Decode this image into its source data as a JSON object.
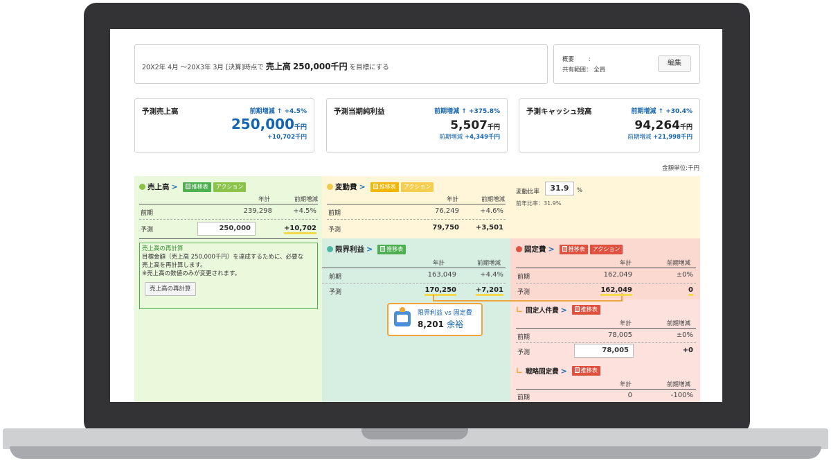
{
  "goal": {
    "prefix": "20X2年 4月 ～20X3年 3月 [決算]時点で",
    "metric": "売上高",
    "amount": "250,000千円",
    "suffix": "を目標にする",
    "overview_label": "概要",
    "overview_value": ":",
    "share_label": "共有範囲：",
    "share_value": "全員",
    "edit_button": "編集"
  },
  "kpis": [
    {
      "title": "予測売上高",
      "delta_label": "前期増減",
      "delta_value": "+4.5%",
      "value": "250,000",
      "unit": "千円",
      "sub": "+10,702千円",
      "accent": "#1565b0"
    },
    {
      "title": "予測当期純利益",
      "delta_label": "前期増減",
      "delta_value": "+375.8%",
      "value": "5,507",
      "unit": "千円",
      "sub_label": "前期増減",
      "sub": "+4,349千円"
    },
    {
      "title": "予測キャッシュ残高",
      "delta_label": "前期増減",
      "delta_value": "+30.4%",
      "value": "94,264",
      "unit": "千円",
      "sub_label": "前期増減",
      "sub": "+21,998千円"
    }
  ],
  "unit_note": "金額単位:千円",
  "col_headers": {
    "year": "年計",
    "delta": "前期増減"
  },
  "sales": {
    "title": "売上高",
    "tag_chart": "推移表",
    "tag_action": "アクション",
    "rows": [
      {
        "label": "前期",
        "value": "239,298",
        "delta": "+4.5%"
      },
      {
        "label": "予測",
        "value": "250,000",
        "delta": "+10,702"
      }
    ],
    "recalc": {
      "title": "売上高の再計算",
      "line1": "目標金額（売上高 250,000千円）を達成するために、必要な",
      "line2": "売上高を再計算します。",
      "line3": "※売上高の数値のみが変更されます。",
      "button": "売上高の再計算"
    }
  },
  "variable": {
    "title": "変動費",
    "tag_chart": "推移表",
    "tag_action": "アクション",
    "rows": [
      {
        "label": "前期",
        "value": "76,249",
        "delta": "+4.6%"
      },
      {
        "label": "予測",
        "value": "79,750",
        "delta": "+3,501"
      }
    ],
    "ratio_label": "変動比率",
    "ratio_value": "31.9",
    "ratio_unit": "%",
    "prev_ratio": "前年比率：31.9%"
  },
  "margin": {
    "title": "限界利益",
    "tag_chart": "推移表",
    "rows": [
      {
        "label": "前期",
        "value": "163,049",
        "delta": "+4.4%"
      },
      {
        "label": "予測",
        "value": "170,250",
        "delta": "+7,201"
      }
    ],
    "callout_title": "限界利益 vs 固定費",
    "callout_value": "8,201",
    "callout_suffix": "余裕"
  },
  "fixed": {
    "title": "固定費",
    "tag_chart": "推移表",
    "tag_action": "アクション",
    "rows": [
      {
        "label": "前期",
        "value": "162,049",
        "delta": "±0%"
      },
      {
        "label": "予測",
        "value": "162,049",
        "delta": "0"
      }
    ]
  },
  "personnel": {
    "title": "固定人件費",
    "tag_chart": "推移表",
    "rows": [
      {
        "label": "前期",
        "value": "78,005",
        "delta": "±0%"
      },
      {
        "label": "予測",
        "value": "78,005",
        "delta": "+0"
      }
    ]
  },
  "strategic": {
    "title": "戦略固定費",
    "tag_chart": "推移表",
    "rows": [
      {
        "label": "前期",
        "value": "0",
        "delta": "-100%"
      }
    ]
  },
  "colors": {
    "green_tag": "#4caf50",
    "action_green": "#8bc34a",
    "yellow_tag": "#f2b705",
    "red_tag": "#e0523f",
    "blue": "#1565b0",
    "orange": "#f2a43b"
  }
}
